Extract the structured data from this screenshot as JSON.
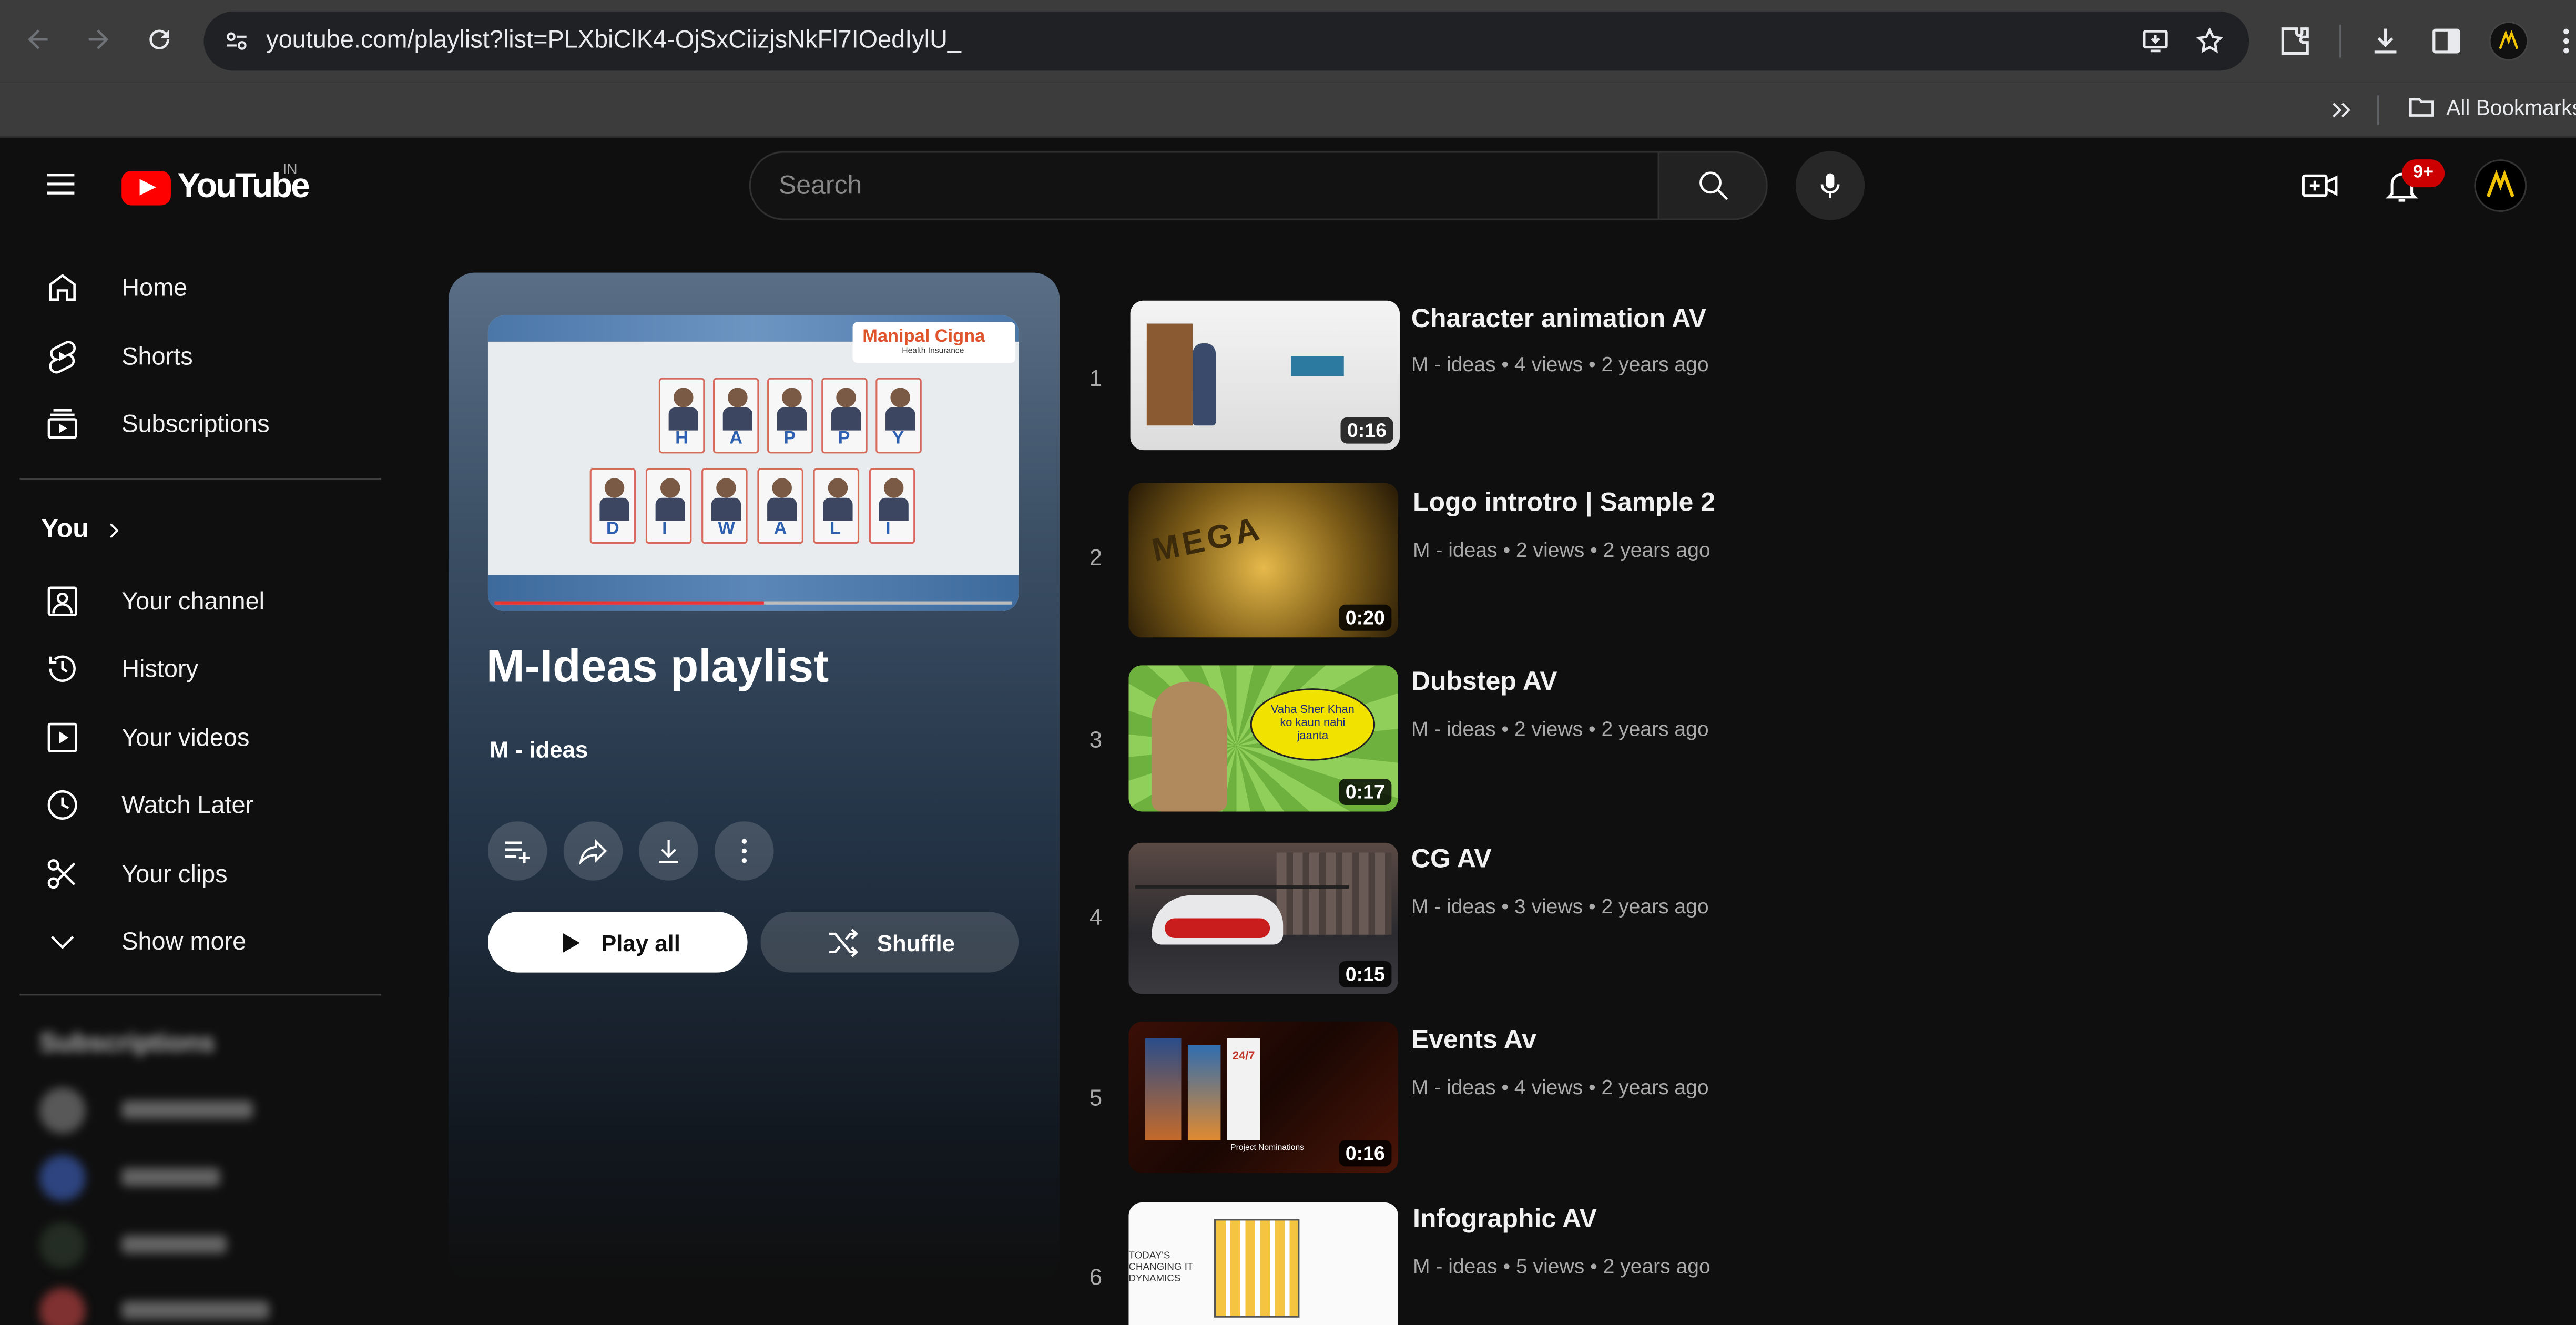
{
  "browser": {
    "url": "youtube.com/playlist?list=PLXbiClK4-OjSxCiizjsNkFl7IOedIylU_",
    "bookmarks_label": "All Bookmarks"
  },
  "header": {
    "logo_text": "YouTube",
    "region": "IN",
    "search_placeholder": "Search",
    "notification_count": "9+"
  },
  "sidebar": {
    "main": [
      {
        "label": "Home",
        "icon": "home-icon"
      },
      {
        "label": "Shorts",
        "icon": "shorts-icon"
      },
      {
        "label": "Subscriptions",
        "icon": "subscriptions-icon"
      }
    ],
    "you_label": "You",
    "you_items": [
      {
        "label": "Your channel",
        "icon": "channel-icon"
      },
      {
        "label": "History",
        "icon": "history-icon"
      },
      {
        "label": "Your videos",
        "icon": "your-videos-icon"
      },
      {
        "label": "Watch Later",
        "icon": "clock-icon"
      },
      {
        "label": "Your clips",
        "icon": "scissors-icon"
      },
      {
        "label": "Show more",
        "icon": "chevron-down-icon"
      }
    ],
    "subscriptions_heading": "Subscriptions"
  },
  "playlist": {
    "title": "M-Ideas playlist",
    "owner": "M - ideas",
    "play_all_label": "Play all",
    "shuffle_label": "Shuffle",
    "thumb_brand": "Manipal Cigna",
    "thumb_brand_sub": "Health Insurance",
    "thumb_letters_top": [
      "H",
      "A",
      "P",
      "P",
      "Y"
    ],
    "thumb_letters_bottom": [
      "D",
      "I",
      "W",
      "A",
      "L",
      "I"
    ]
  },
  "videos": [
    {
      "index": "1",
      "title": "Character animation AV",
      "channel": "M - ideas",
      "views": "4 views",
      "age": "2 years ago",
      "duration": "0:16"
    },
    {
      "index": "2",
      "title": "Logo introtro | Sample 2",
      "channel": "M - ideas",
      "views": "2 views",
      "age": "2 years ago",
      "duration": "0:20"
    },
    {
      "index": "3",
      "title": "Dubstep AV",
      "channel": "M - ideas",
      "views": "2 views",
      "age": "2 years ago",
      "duration": "0:17"
    },
    {
      "index": "4",
      "title": "CG AV",
      "channel": "M - ideas",
      "views": "3 views",
      "age": "2 years ago",
      "duration": "0:15"
    },
    {
      "index": "5",
      "title": "Events Av",
      "channel": "M - ideas",
      "views": "4 views",
      "age": "2 years ago",
      "duration": "0:16"
    },
    {
      "index": "6",
      "title": "Infographic AV",
      "channel": "M - ideas",
      "views": "5 views",
      "age": "2 years ago",
      "duration": ""
    }
  ],
  "thumb_texts": {
    "dubstep_bubble": "Vaha Sher Khan ko kaun nahi jaanta",
    "logo_intro": "MEGA",
    "events_sign": "24/7",
    "events_caption": "Project Nominations",
    "infographic": "TODAY'S CHANGING IT DYNAMICS"
  },
  "colors": {
    "accent_red": "#ff0000",
    "background": "#0f0f0f"
  }
}
